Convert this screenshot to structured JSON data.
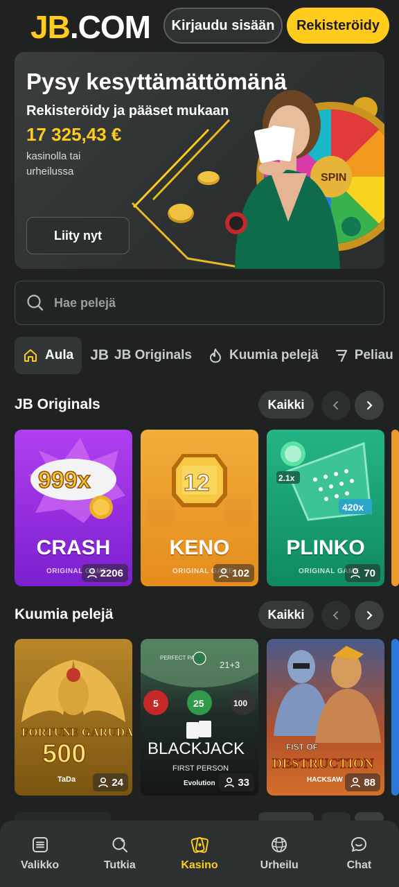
{
  "header": {
    "logo": "JB.COM",
    "login_label": "Kirjaudu sisään",
    "register_label": "Rekisteröidy"
  },
  "banner": {
    "title": "Pysy kesyttämättömänä",
    "subtitle": "Rekisteröidy ja pääset mukaan",
    "amount": "17 325,43 €",
    "note": "kasinolla tai urheilussa",
    "cta_label": "Liity nyt",
    "wheel_text": "SPIN"
  },
  "search": {
    "placeholder": "Hae pelejä",
    "icon": "search-icon"
  },
  "tabs": [
    {
      "label": "Aula",
      "icon": "home-icon",
      "active": true
    },
    {
      "label": "JB Originals",
      "icon": "jb-icon",
      "active": false
    },
    {
      "label": "Kuumia pelejä",
      "icon": "flame-icon",
      "active": false
    },
    {
      "label": "Peliau",
      "icon": "slot-seven-icon",
      "active": false
    }
  ],
  "jb_originals": {
    "title": "JB Originals",
    "all_label": "Kaikki",
    "games": [
      {
        "name": "CRASH",
        "provider": "ORIGINAL GAME",
        "players": "2206",
        "badge": "999x"
      },
      {
        "name": "KENO",
        "provider": "ORIGINAL GAME",
        "players": "102",
        "badge": "12"
      },
      {
        "name": "PLINKO",
        "provider": "ORIGINAL GAME",
        "players": "70",
        "badge_a": "2.1x",
        "badge_b": "420x"
      }
    ]
  },
  "hot_games": {
    "title": "Kuumia pelejä",
    "all_label": "Kaikki",
    "games": [
      {
        "name": "FORTUNE GARUDA",
        "number": "500",
        "provider": "TaDa",
        "players": "24"
      },
      {
        "name": "BLACKJACK",
        "subtitle": "FIRST PERSON",
        "provider": "Evolution",
        "players": "33",
        "chips": [
          "5",
          "25",
          "100"
        ],
        "table_text_a": "PERFECT PAIRS",
        "table_text_b": "21+3"
      },
      {
        "name": "FIST OF DESTRUCTION",
        "provider": "HACKSAW",
        "players": "88"
      }
    ]
  },
  "bottom_nav": [
    {
      "label": "Valikko",
      "icon": "menu-icon",
      "active": false
    },
    {
      "label": "Tutkia",
      "icon": "explore-icon",
      "active": false
    },
    {
      "label": "Kasino",
      "icon": "casino-icon",
      "active": true
    },
    {
      "label": "Urheilu",
      "icon": "sports-ball-icon",
      "active": false
    },
    {
      "label": "Chat",
      "icon": "chat-icon",
      "active": false
    }
  ],
  "colors": {
    "accent": "#ffcc1e",
    "background": "#202222",
    "crash": "#9b2de0",
    "keno": "#f0a22a",
    "plinko": "#17a57a"
  }
}
